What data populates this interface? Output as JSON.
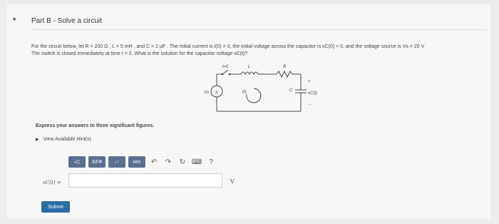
{
  "part": {
    "caret": "▾",
    "title": "Part B - Solve a circuit"
  },
  "problem": {
    "line1": "For the circuit below, let R = 200 Ω , L = 5 mH , and C = 2 µF . The initial current is i(0) = 0, the initial voltage across the capacitor is vC(0) = 0, and the voltage source is Vs = 20 V",
    "line2": "The switch is closed immediately at time t = 0. What is the solution for the capacitor voltage vC(t)?"
  },
  "circuit": {
    "switch_label": "t=0",
    "inductor_label": "L",
    "resistor_label": "R",
    "source_label": "Vs",
    "current_label": "i(t)",
    "capacitor_label": "C",
    "plus": "+",
    "minus": "−",
    "vc_label": "vC(t)"
  },
  "instructions": "Express your answers to three significant figures.",
  "hints": {
    "arrow": "▶",
    "label": "View Available Hint(s)"
  },
  "toolbar": {
    "templates": "√▯",
    "greek": "ΑΣΦ",
    "arrows": "↓↑",
    "vec": "vec",
    "undo": "↶",
    "redo": "↷",
    "reset": "↻",
    "keyboard": "⌨",
    "help": "?"
  },
  "answer": {
    "label": "vC(t) =",
    "value": "",
    "unit": "V"
  },
  "submit_label": "Submit"
}
